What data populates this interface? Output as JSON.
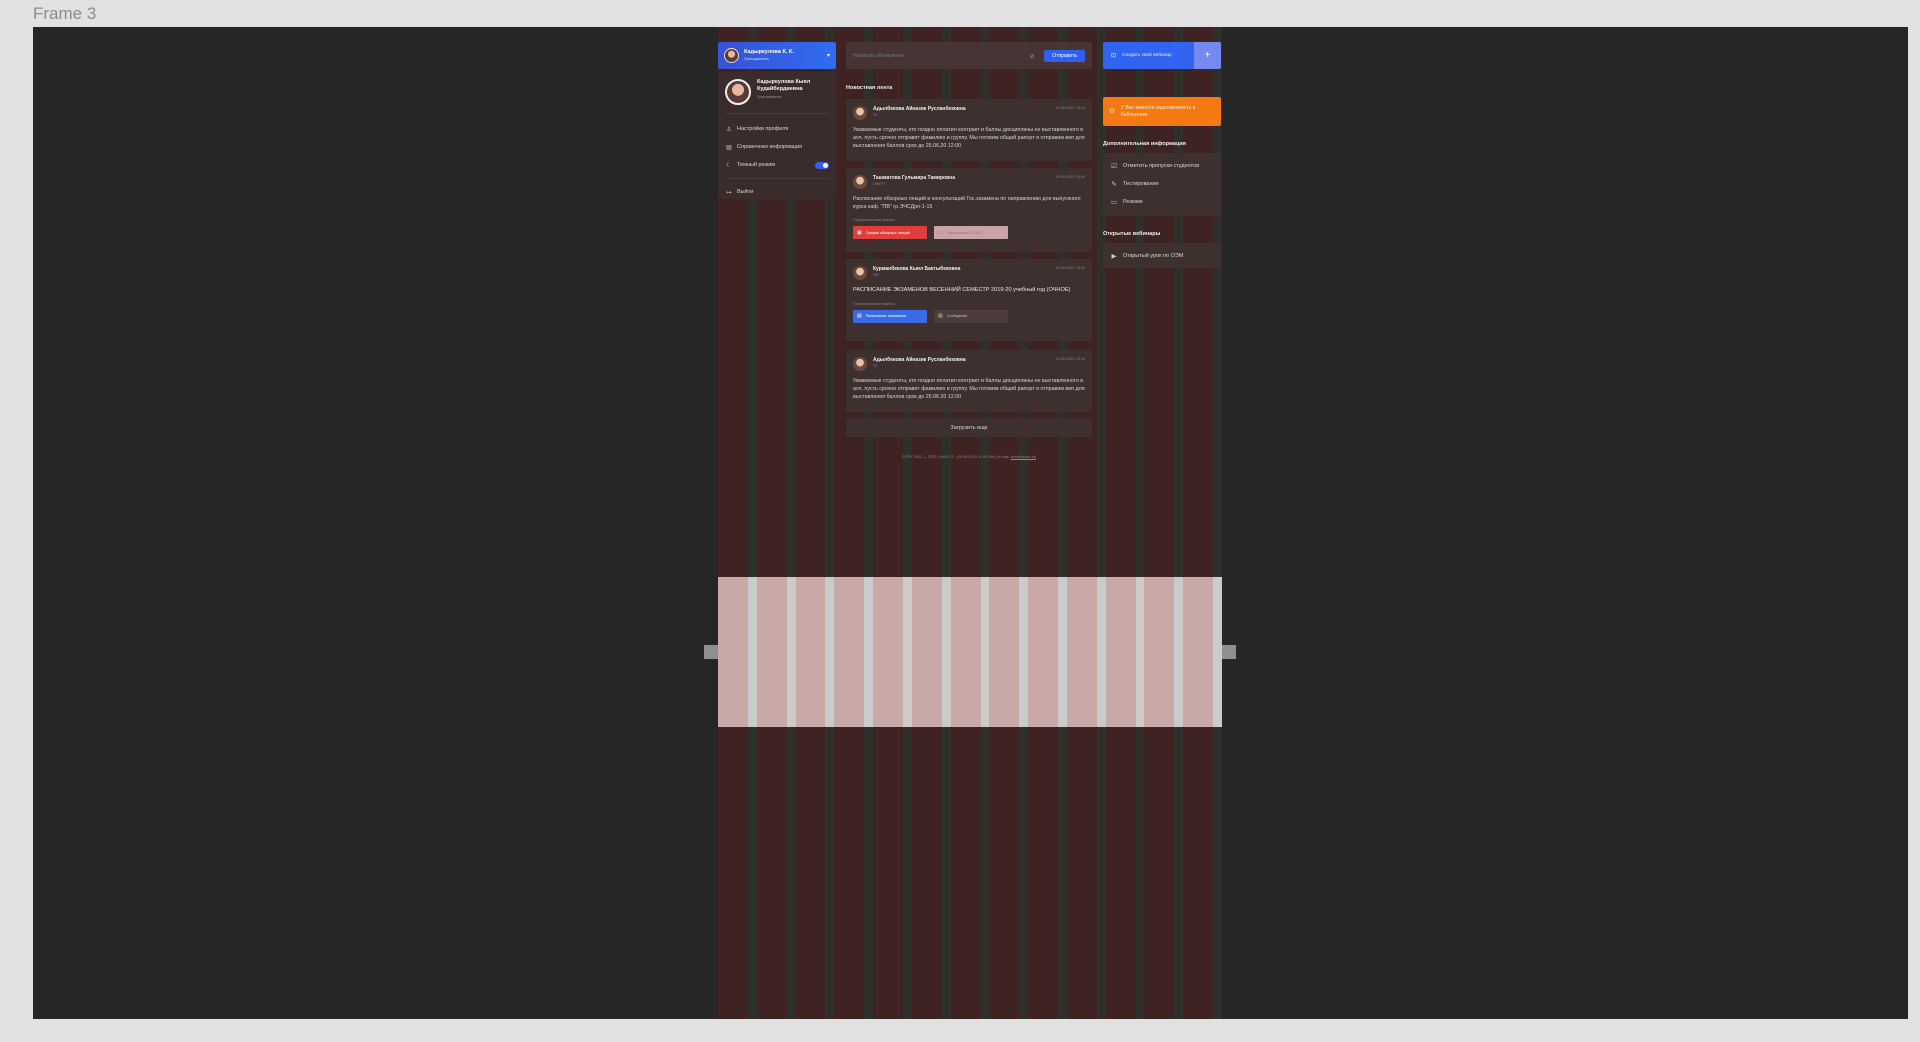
{
  "frame": {
    "label": "Frame 3"
  },
  "header": {
    "user_name": "Кадыркулова К. К.",
    "user_role": "Преподаватель"
  },
  "profile": {
    "name_line1": "Кадыркулова Кыял",
    "name_line2": "Кудайбердиевна",
    "role": "Преподаватель",
    "menu": [
      {
        "icon": "user-icon",
        "label": "Настройки профиля"
      },
      {
        "icon": "info-book-icon",
        "label": "Справочная информация"
      },
      {
        "icon": "moon-icon",
        "label": "Темный режим",
        "toggle_on": true
      },
      {
        "icon": "logout-icon",
        "label": "Выйти"
      }
    ]
  },
  "composer": {
    "placeholder": "Написать объявление",
    "send_label": "Отправить"
  },
  "feed": {
    "title": "Новостная лента",
    "posts": [
      {
        "author": "Адылбекова Айназик Русланбековна",
        "sub": "УК",
        "date": "12.06.2020 / 19:44",
        "text": "Уважаемые студенты, кто поздно оплатил контракт и баллы дисциплины не выставленного в avn, пусть срочно отправят фамилию и группу. Мы готовим общий рапорт и отправим вип для выставления баллов срок до 25.06.20 12:00"
      },
      {
        "author": "Ташматова Гульмира Тамировна",
        "sub": "ОФиТН",
        "date": "09.06.2020 / 20:50",
        "text": "Расписание обзорных лекций и консультаций Гос.экзамена по направлению для выпускного курса каф. \"ПВ\" гр.ЭЧСДрп-1-15",
        "files_label": "Прикрепленные файлы",
        "files": [
          {
            "name": "График обзорных лекций",
            "icon": "pdf-icon"
          },
          {
            "name": "Расписание ГЭ ЭЧС",
            "icon": "doc-icon"
          }
        ]
      },
      {
        "author": "Курманбекова Кыял Бактыбековна",
        "sub": "ОФ",
        "date": "03.06.2020 / 15:00",
        "text": "РАСПИСАНИЕ ЭКЗАМЕНОВ ВЕСЕННИЙ СЕМЕСТР 2019-20 учебный год (ОЧНОЕ)",
        "files_label": "Прикрепленные файлы",
        "files": [
          {
            "name": "Расписание экзаменов",
            "icon": "doc-icon"
          },
          {
            "name": "Сообщение",
            "icon": "doc-icon"
          }
        ]
      },
      {
        "author": "Адылбекова Айназик Русланбековна",
        "sub": "УК",
        "date": "12.06.2020 / 19:44",
        "text": "Уважаемые студенты, кто поздно оплатил контракт и баллы дисциплины не выставленного в avn, пусть срочно отправят фамилию и группу. Мы готовим общий рапорт и отправим вип для выставления баллов срок до 25.06.20 12:00"
      }
    ],
    "load_more": "Загрузить еще",
    "footer_text": "©ЯРУ 2022 — 2023 | AVN 2.2 - (26.06.2019 11:32 AM) | e-mail: ",
    "footer_email": "avn@oshsu.kg"
  },
  "right": {
    "webinar_label": "Создать свой вебинар",
    "webinar_plus": "+",
    "alert_text": "У Вас имеется задолженность в библиотеке",
    "extra_title": "Дополнительная информация",
    "extra_items": [
      {
        "icon": "check-square-icon",
        "label": "Отметить пропуски студентов"
      },
      {
        "icon": "test-icon",
        "label": "Тестирование"
      },
      {
        "icon": "resume-icon",
        "label": "Резюме"
      }
    ],
    "webinars_title": "Открытые вебинары",
    "webinars": [
      {
        "icon": "play-icon",
        "label": "Открытый урок по ОЭМ"
      }
    ]
  }
}
